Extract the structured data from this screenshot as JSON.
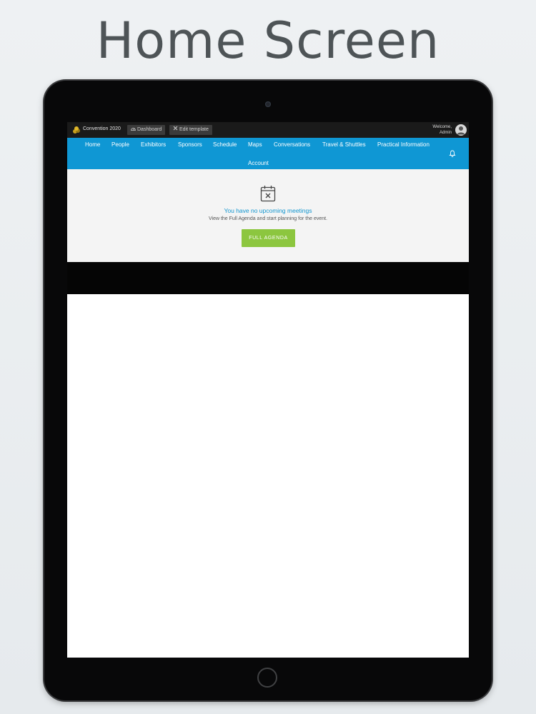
{
  "headline": "Home Screen",
  "topbar": {
    "brand": "Convention 2020",
    "dashboard_label": "Dashboard",
    "edit_template_label": "Edit template",
    "welcome_line1": "Welcome,",
    "welcome_line2": "Admin"
  },
  "nav": {
    "items": [
      "Home",
      "People",
      "Exhibitors",
      "Sponsors",
      "Schedule",
      "Maps",
      "Conversations",
      "Travel & Shuttles",
      "Practical Information",
      "Account"
    ]
  },
  "meetings": {
    "title": "You have no upcoming meetings",
    "subtitle": "View the Full Agenda and start planning for the event.",
    "button_label": "FULL AGENDA"
  },
  "colors": {
    "nav_blue": "#0f97d4",
    "button_green": "#8cc63f",
    "title_blue": "#1396cf"
  },
  "icons": [
    "brand-logo-icon",
    "dashboard-icon",
    "wrench-icon",
    "avatar-icon",
    "bell-icon",
    "calendar-x-icon",
    "camera",
    "home-button"
  ]
}
